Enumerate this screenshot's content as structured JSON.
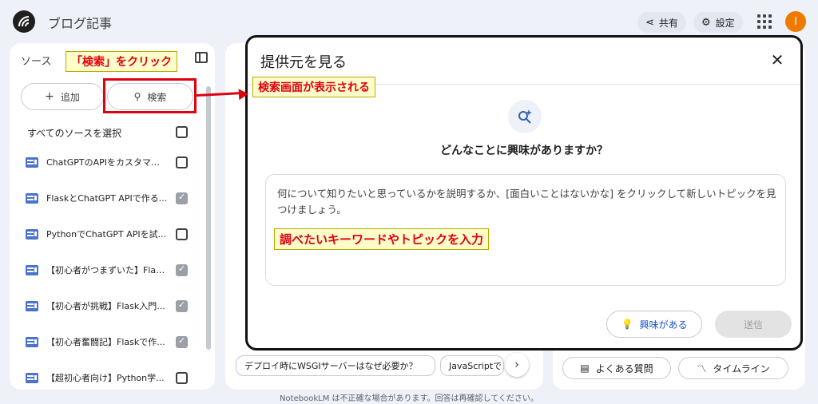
{
  "header": {
    "app_title": "ブログ記事",
    "share_label": "共有",
    "settings_label": "設定",
    "avatar_initial": "I"
  },
  "sources": {
    "title": "ソース",
    "add_label": "追加",
    "search_label": "検索",
    "select_all_label": "すべてのソースを選択",
    "items": [
      {
        "label": "ChatGPTのAPIをカスタマイズ...",
        "checked": false
      },
      {
        "label": "FlaskとChatGPT APIで作る...",
        "checked": true
      },
      {
        "label": "PythonでChatGPT APIを試...",
        "checked": false
      },
      {
        "label": "【初心者がつまずいた】Flas...",
        "checked": true
      },
      {
        "label": "【初心者が挑戦】Flask入門...",
        "checked": true
      },
      {
        "label": "【初心者奮闘記】Flaskで作...",
        "checked": true
      },
      {
        "label": "【超初心者向け】Python学...",
        "checked": false
      }
    ]
  },
  "chat": {
    "suggestions": [
      "デプロイ時にWSGIサーバーはなぜ必要か？",
      "JavaScriptで"
    ]
  },
  "studio": {
    "faq_label": "よくある質問",
    "timeline_label": "タイムライン"
  },
  "modal": {
    "title": "提供元を見る",
    "question": "どんなことに興味がありますか？",
    "placeholder": "何について知りたいと思っているかを説明するか、[面白いことはないかな] をクリックして新しいトピックを見つけましょう。",
    "interest_label": "興味がある",
    "send_label": "送信"
  },
  "annotations": {
    "click_search": "「検索」をクリック",
    "search_screen": "検索画面が表示される",
    "enter_keyword": "調べたいキーワードやトピックを入力"
  },
  "footer": {
    "disclaimer": "NotebookLM は不正確な場合があります。回答は再確認してください。"
  },
  "colors": {
    "accent": "#1a56c4",
    "annotation_red": "#e0000f",
    "annotation_bg": "#fffdc9",
    "avatar": "#ee7a00"
  }
}
